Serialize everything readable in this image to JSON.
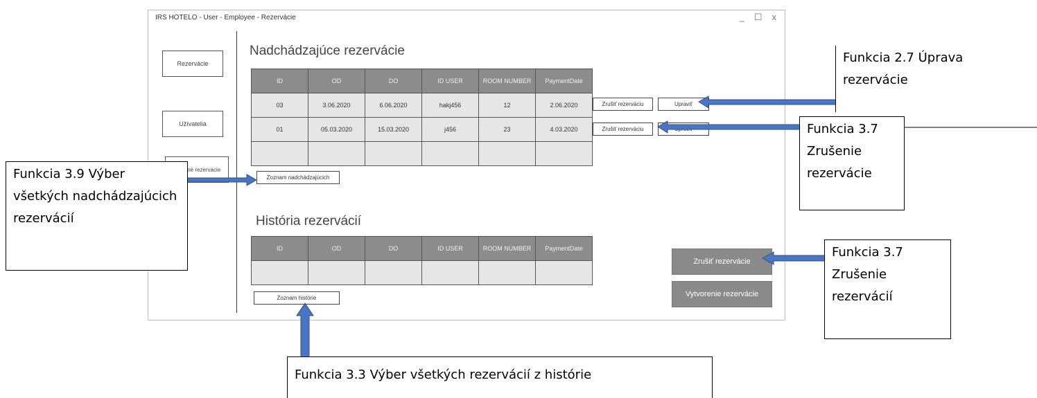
{
  "window": {
    "title": "IRS HOTELO - User - Employee - Rezervácie",
    "controls": {
      "minimize": "_",
      "maximize": "☐",
      "close": "x"
    }
  },
  "sidebar": {
    "items": [
      {
        "label": "Rezervácie"
      },
      {
        "label": "Užívatelia"
      },
      {
        "label": "Zrušené rezervácie"
      }
    ]
  },
  "upcoming": {
    "title": "Nadchádzajúce rezervácie",
    "columns": [
      "ID",
      "OD",
      "DO",
      "ID USER",
      "ROOM NUMBER",
      "PaymentDate"
    ],
    "rows": [
      [
        "03",
        "3.06.2020",
        "6.06.2020",
        "hakj456",
        "12",
        "2.06.2020"
      ],
      [
        "01",
        "05.03.2020",
        "15.03.2020",
        "j456",
        "23",
        "4.03.2020"
      ],
      [
        "",
        "",
        "",
        "",
        "",
        ""
      ]
    ],
    "row_actions": [
      {
        "cancel": "Zrušiť rezerváciu",
        "edit": "Upraviť"
      },
      {
        "cancel": "Zrušiť rezerváciu",
        "edit": "Upraviť"
      }
    ],
    "list_button": "Zoznam nadchádzajúcich"
  },
  "history": {
    "title": "História rezervácií",
    "columns": [
      "ID",
      "OD",
      "DO",
      "ID USER",
      "ROOM NUMBER",
      "PaymentDate"
    ],
    "rows": [
      [
        "",
        "",
        "",
        "",
        "",
        ""
      ]
    ],
    "list_button": "Zoznam histórie"
  },
  "actions": {
    "cancel_reservations": "Zrušiť rezervácie",
    "create_reservation": "Vytvorenie rezervácie"
  },
  "annotations": {
    "edit_fn": "Funkcia 2.7 Úprava rezervácie",
    "cancel_fn": "Funkcia 3.7 Zrušenie rezervácie",
    "select_upcoming": "Funkcia 3.9 Výber všetkých nadchádzajúcich rezervácií",
    "cancel_all": "Funkcia 3.7 Zrušenie rezervácií",
    "select_history": "Funkcia 3.3 Výber všetkých rezervácií z histórie"
  },
  "colors": {
    "arrow": "#4a74c4",
    "arrow_border": "#2f528f",
    "header_gray": "#8c8c8c",
    "cell_gray": "#e6e6e6"
  }
}
